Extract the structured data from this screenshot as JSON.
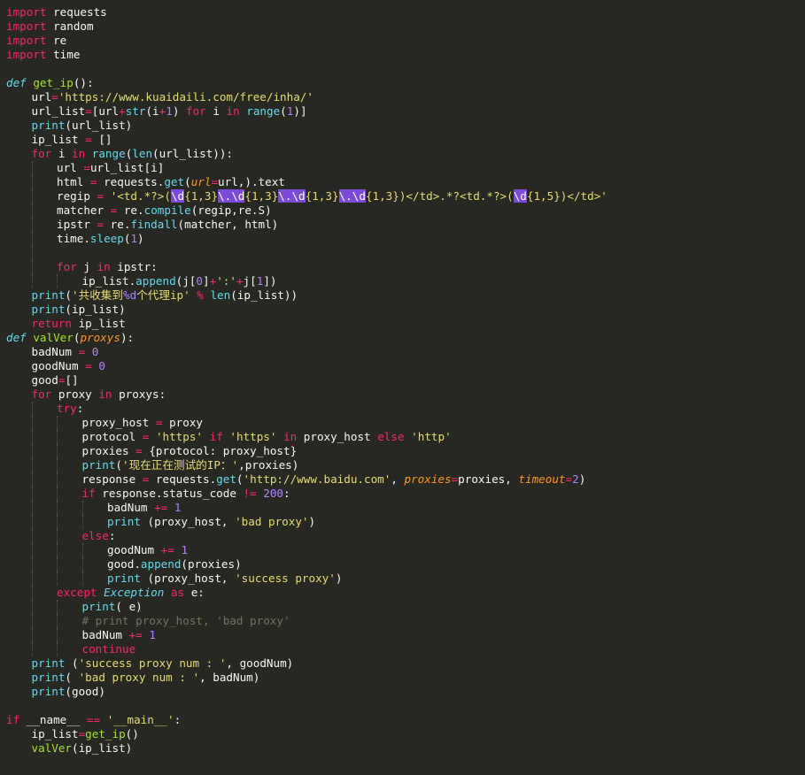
{
  "editor": {
    "language": "python",
    "theme_colors": {
      "background": "#272822",
      "text": "#f8f8f2",
      "keyword": "#f92672",
      "function": "#a6e22e",
      "builtin": "#66d9ef",
      "string": "#e6db74",
      "number": "#ae81ff",
      "parameter": "#fd971f",
      "comment": "#75715e",
      "selection": "#7b4bd8"
    },
    "lines": [
      {
        "indent": 0,
        "tokens": [
          [
            "kw",
            "import"
          ],
          [
            "pl",
            " requests"
          ]
        ]
      },
      {
        "indent": 0,
        "tokens": [
          [
            "kw",
            "import"
          ],
          [
            "pl",
            " random"
          ]
        ]
      },
      {
        "indent": 0,
        "tokens": [
          [
            "kw",
            "import"
          ],
          [
            "pl",
            " re"
          ]
        ]
      },
      {
        "indent": 0,
        "tokens": [
          [
            "kw",
            "import"
          ],
          [
            "pl",
            " time"
          ]
        ]
      },
      {
        "indent": 0,
        "tokens": []
      },
      {
        "indent": 0,
        "tokens": [
          [
            "kwi",
            "def"
          ],
          [
            "pl",
            " "
          ],
          [
            "fn",
            "get_ip"
          ],
          [
            "pl",
            "():"
          ]
        ]
      },
      {
        "indent": 1,
        "tokens": [
          [
            "pl",
            "url"
          ],
          [
            "op",
            "="
          ],
          [
            "st",
            "'https://www.kuaidaili.com/free/inha/'"
          ]
        ]
      },
      {
        "indent": 1,
        "tokens": [
          [
            "pl",
            "url_list"
          ],
          [
            "op",
            "="
          ],
          [
            "pl",
            "[url"
          ],
          [
            "op",
            "+"
          ],
          [
            "bi",
            "str"
          ],
          [
            "pl",
            "(i"
          ],
          [
            "op",
            "+"
          ],
          [
            "nu",
            "1"
          ],
          [
            "pl",
            ") "
          ],
          [
            "kw",
            "for"
          ],
          [
            "pl",
            " i "
          ],
          [
            "kw",
            "in"
          ],
          [
            "pl",
            " "
          ],
          [
            "bi",
            "range"
          ],
          [
            "pl",
            "("
          ],
          [
            "nu",
            "1"
          ],
          [
            "pl",
            ")]"
          ]
        ]
      },
      {
        "indent": 1,
        "tokens": [
          [
            "bi",
            "print"
          ],
          [
            "pl",
            "(url_list)"
          ]
        ]
      },
      {
        "indent": 1,
        "tokens": [
          [
            "pl",
            "ip_list "
          ],
          [
            "op",
            "="
          ],
          [
            "pl",
            " []"
          ]
        ]
      },
      {
        "indent": 1,
        "tokens": [
          [
            "kw",
            "for"
          ],
          [
            "pl",
            " i "
          ],
          [
            "kw",
            "in"
          ],
          [
            "pl",
            " "
          ],
          [
            "bi",
            "range"
          ],
          [
            "pl",
            "("
          ],
          [
            "bi",
            "len"
          ],
          [
            "pl",
            "(url_list)):"
          ]
        ]
      },
      {
        "indent": 2,
        "tokens": [
          [
            "pl",
            "url "
          ],
          [
            "op",
            "="
          ],
          [
            "pl",
            "url_list[i]"
          ]
        ]
      },
      {
        "indent": 2,
        "tokens": [
          [
            "pl",
            "html "
          ],
          [
            "op",
            "="
          ],
          [
            "pl",
            " requests."
          ],
          [
            "bi",
            "get"
          ],
          [
            "pl",
            "("
          ],
          [
            "pa",
            "url"
          ],
          [
            "op",
            "="
          ],
          [
            "pl",
            "url,).text"
          ]
        ]
      },
      {
        "indent": 2,
        "tokens": [
          [
            "pl",
            "regip "
          ],
          [
            "op",
            "="
          ],
          [
            "pl",
            " "
          ],
          [
            "st",
            "'<td.*?>("
          ],
          [
            "hl",
            "\\d"
          ],
          [
            "st",
            "{1,3}"
          ],
          [
            "hl",
            "\\."
          ],
          [
            "hl",
            "\\d"
          ],
          [
            "st",
            "{1,3}"
          ],
          [
            "hl",
            "\\."
          ],
          [
            "hl",
            "\\d"
          ],
          [
            "st",
            "{1,3}"
          ],
          [
            "hl",
            "\\."
          ],
          [
            "hl",
            "\\d"
          ],
          [
            "st",
            "{1,3})</td>.*?<td.*?>("
          ],
          [
            "hl",
            "\\d"
          ],
          [
            "st",
            "{1,5})</td>'"
          ]
        ]
      },
      {
        "indent": 2,
        "tokens": [
          [
            "pl",
            "matcher "
          ],
          [
            "op",
            "="
          ],
          [
            "pl",
            " re."
          ],
          [
            "bi",
            "compile"
          ],
          [
            "pl",
            "(regip,re.S)"
          ]
        ]
      },
      {
        "indent": 2,
        "tokens": [
          [
            "pl",
            "ipstr "
          ],
          [
            "op",
            "="
          ],
          [
            "pl",
            " re."
          ],
          [
            "bi",
            "findall"
          ],
          [
            "pl",
            "(matcher, html)"
          ]
        ]
      },
      {
        "indent": 2,
        "tokens": [
          [
            "pl",
            "time."
          ],
          [
            "bi",
            "sleep"
          ],
          [
            "pl",
            "("
          ],
          [
            "nu",
            "1"
          ],
          [
            "pl",
            ")"
          ]
        ]
      },
      {
        "indent": 2,
        "tokens": []
      },
      {
        "indent": 2,
        "tokens": [
          [
            "kw",
            "for"
          ],
          [
            "pl",
            " j "
          ],
          [
            "kw",
            "in"
          ],
          [
            "pl",
            " ipstr:"
          ]
        ]
      },
      {
        "indent": 3,
        "tokens": [
          [
            "pl",
            "ip_list."
          ],
          [
            "bi",
            "append"
          ],
          [
            "pl",
            "(j["
          ],
          [
            "nu",
            "0"
          ],
          [
            "pl",
            "]"
          ],
          [
            "op",
            "+"
          ],
          [
            "st",
            "':'"
          ],
          [
            "op",
            "+"
          ],
          [
            "pl",
            "j["
          ],
          [
            "nu",
            "1"
          ],
          [
            "pl",
            "])"
          ]
        ]
      },
      {
        "indent": 1,
        "tokens": [
          [
            "bi",
            "print"
          ],
          [
            "pl",
            "("
          ],
          [
            "st",
            "'共收集到"
          ],
          [
            "nu",
            "%d"
          ],
          [
            "st",
            "个代理ip'"
          ],
          [
            "pl",
            " "
          ],
          [
            "op",
            "%"
          ],
          [
            "pl",
            " "
          ],
          [
            "bi",
            "len"
          ],
          [
            "pl",
            "(ip_list))"
          ]
        ]
      },
      {
        "indent": 1,
        "tokens": [
          [
            "bi",
            "print"
          ],
          [
            "pl",
            "(ip_list)"
          ]
        ]
      },
      {
        "indent": 1,
        "tokens": [
          [
            "kw",
            "return"
          ],
          [
            "pl",
            " ip_list"
          ]
        ]
      },
      {
        "indent": 0,
        "tokens": [
          [
            "kwi",
            "def"
          ],
          [
            "pl",
            " "
          ],
          [
            "fn",
            "valVer"
          ],
          [
            "pl",
            "("
          ],
          [
            "pa",
            "proxys"
          ],
          [
            "pl",
            "):"
          ]
        ]
      },
      {
        "indent": 1,
        "tokens": [
          [
            "pl",
            "badNum "
          ],
          [
            "op",
            "="
          ],
          [
            "pl",
            " "
          ],
          [
            "nu",
            "0"
          ]
        ]
      },
      {
        "indent": 1,
        "tokens": [
          [
            "pl",
            "goodNum "
          ],
          [
            "op",
            "="
          ],
          [
            "pl",
            " "
          ],
          [
            "nu",
            "0"
          ]
        ]
      },
      {
        "indent": 1,
        "tokens": [
          [
            "pl",
            "good"
          ],
          [
            "op",
            "="
          ],
          [
            "pl",
            "[]"
          ]
        ]
      },
      {
        "indent": 1,
        "tokens": [
          [
            "kw",
            "for"
          ],
          [
            "pl",
            " proxy "
          ],
          [
            "kw",
            "in"
          ],
          [
            "pl",
            " proxys:"
          ]
        ]
      },
      {
        "indent": 2,
        "tokens": [
          [
            "kw",
            "try"
          ],
          [
            "pl",
            ":"
          ]
        ]
      },
      {
        "indent": 3,
        "tokens": [
          [
            "pl",
            "proxy_host "
          ],
          [
            "op",
            "="
          ],
          [
            "pl",
            " proxy"
          ]
        ]
      },
      {
        "indent": 3,
        "tokens": [
          [
            "pl",
            "protocol "
          ],
          [
            "op",
            "="
          ],
          [
            "pl",
            " "
          ],
          [
            "st",
            "'https'"
          ],
          [
            "pl",
            " "
          ],
          [
            "kw",
            "if"
          ],
          [
            "pl",
            " "
          ],
          [
            "st",
            "'https'"
          ],
          [
            "pl",
            " "
          ],
          [
            "kw",
            "in"
          ],
          [
            "pl",
            " proxy_host "
          ],
          [
            "kw",
            "else"
          ],
          [
            "pl",
            " "
          ],
          [
            "st",
            "'http'"
          ]
        ]
      },
      {
        "indent": 3,
        "tokens": [
          [
            "pl",
            "proxies "
          ],
          [
            "op",
            "="
          ],
          [
            "pl",
            " {protocol: proxy_host}"
          ]
        ]
      },
      {
        "indent": 3,
        "tokens": [
          [
            "bi",
            "print"
          ],
          [
            "pl",
            "("
          ],
          [
            "st",
            "'现在正在测试的IP：'"
          ],
          [
            "pl",
            ",proxies)"
          ]
        ]
      },
      {
        "indent": 3,
        "tokens": [
          [
            "pl",
            "response "
          ],
          [
            "op",
            "="
          ],
          [
            "pl",
            " requests."
          ],
          [
            "bi",
            "get"
          ],
          [
            "pl",
            "("
          ],
          [
            "st",
            "'http://www.baidu.com'"
          ],
          [
            "pl",
            ", "
          ],
          [
            "pa",
            "proxies"
          ],
          [
            "op",
            "="
          ],
          [
            "pl",
            "proxies, "
          ],
          [
            "pa",
            "timeout"
          ],
          [
            "op",
            "="
          ],
          [
            "nu",
            "2"
          ],
          [
            "pl",
            ")"
          ]
        ]
      },
      {
        "indent": 3,
        "tokens": [
          [
            "kw",
            "if"
          ],
          [
            "pl",
            " response.status_code "
          ],
          [
            "op",
            "!="
          ],
          [
            "pl",
            " "
          ],
          [
            "nu",
            "200"
          ],
          [
            "pl",
            ":"
          ]
        ]
      },
      {
        "indent": 4,
        "tokens": [
          [
            "pl",
            "badNum "
          ],
          [
            "op",
            "+="
          ],
          [
            "pl",
            " "
          ],
          [
            "nu",
            "1"
          ]
        ]
      },
      {
        "indent": 4,
        "tokens": [
          [
            "bi",
            "print"
          ],
          [
            "pl",
            " (proxy_host, "
          ],
          [
            "st",
            "'bad proxy'"
          ],
          [
            "pl",
            ")"
          ]
        ]
      },
      {
        "indent": 3,
        "tokens": [
          [
            "kw",
            "else"
          ],
          [
            "pl",
            ":"
          ]
        ]
      },
      {
        "indent": 4,
        "tokens": [
          [
            "pl",
            "goodNum "
          ],
          [
            "op",
            "+="
          ],
          [
            "pl",
            " "
          ],
          [
            "nu",
            "1"
          ]
        ]
      },
      {
        "indent": 4,
        "tokens": [
          [
            "pl",
            "good."
          ],
          [
            "bi",
            "append"
          ],
          [
            "pl",
            "(proxies)"
          ]
        ]
      },
      {
        "indent": 4,
        "tokens": [
          [
            "bi",
            "print"
          ],
          [
            "pl",
            " (proxy_host, "
          ],
          [
            "st",
            "'success proxy'"
          ],
          [
            "pl",
            ")"
          ]
        ]
      },
      {
        "indent": 2,
        "tokens": [
          [
            "kw",
            "except"
          ],
          [
            "pl",
            " "
          ],
          [
            "cls",
            "Exception"
          ],
          [
            "pl",
            " "
          ],
          [
            "kw",
            "as"
          ],
          [
            "pl",
            " e:"
          ]
        ]
      },
      {
        "indent": 3,
        "tokens": [
          [
            "bi",
            "print"
          ],
          [
            "pl",
            "( e)"
          ]
        ]
      },
      {
        "indent": 3,
        "tokens": [
          [
            "cm",
            "# print proxy_host, 'bad proxy'"
          ]
        ]
      },
      {
        "indent": 3,
        "tokens": [
          [
            "pl",
            "badNum "
          ],
          [
            "op",
            "+="
          ],
          [
            "pl",
            " "
          ],
          [
            "nu",
            "1"
          ]
        ]
      },
      {
        "indent": 3,
        "tokens": [
          [
            "kw",
            "continue"
          ]
        ]
      },
      {
        "indent": 1,
        "tokens": [
          [
            "bi",
            "print"
          ],
          [
            "pl",
            " ("
          ],
          [
            "st",
            "'success proxy num : '"
          ],
          [
            "pl",
            ", goodNum)"
          ]
        ]
      },
      {
        "indent": 1,
        "tokens": [
          [
            "bi",
            "print"
          ],
          [
            "pl",
            "( "
          ],
          [
            "st",
            "'bad proxy num : '"
          ],
          [
            "pl",
            ", badNum)"
          ]
        ]
      },
      {
        "indent": 1,
        "tokens": [
          [
            "bi",
            "print"
          ],
          [
            "pl",
            "(good)"
          ]
        ]
      },
      {
        "indent": 0,
        "tokens": []
      },
      {
        "indent": 0,
        "tokens": [
          [
            "kw",
            "if"
          ],
          [
            "pl",
            " __name__ "
          ],
          [
            "op",
            "=="
          ],
          [
            "pl",
            " "
          ],
          [
            "st",
            "'__main__'"
          ],
          [
            "pl",
            ":"
          ]
        ]
      },
      {
        "indent": 1,
        "tokens": [
          [
            "pl",
            "ip_list"
          ],
          [
            "op",
            "="
          ],
          [
            "fn",
            "get_ip"
          ],
          [
            "pl",
            "()"
          ]
        ]
      },
      {
        "indent": 1,
        "tokens": [
          [
            "fn",
            "valVer"
          ],
          [
            "pl",
            "(ip_list)"
          ]
        ]
      }
    ]
  }
}
